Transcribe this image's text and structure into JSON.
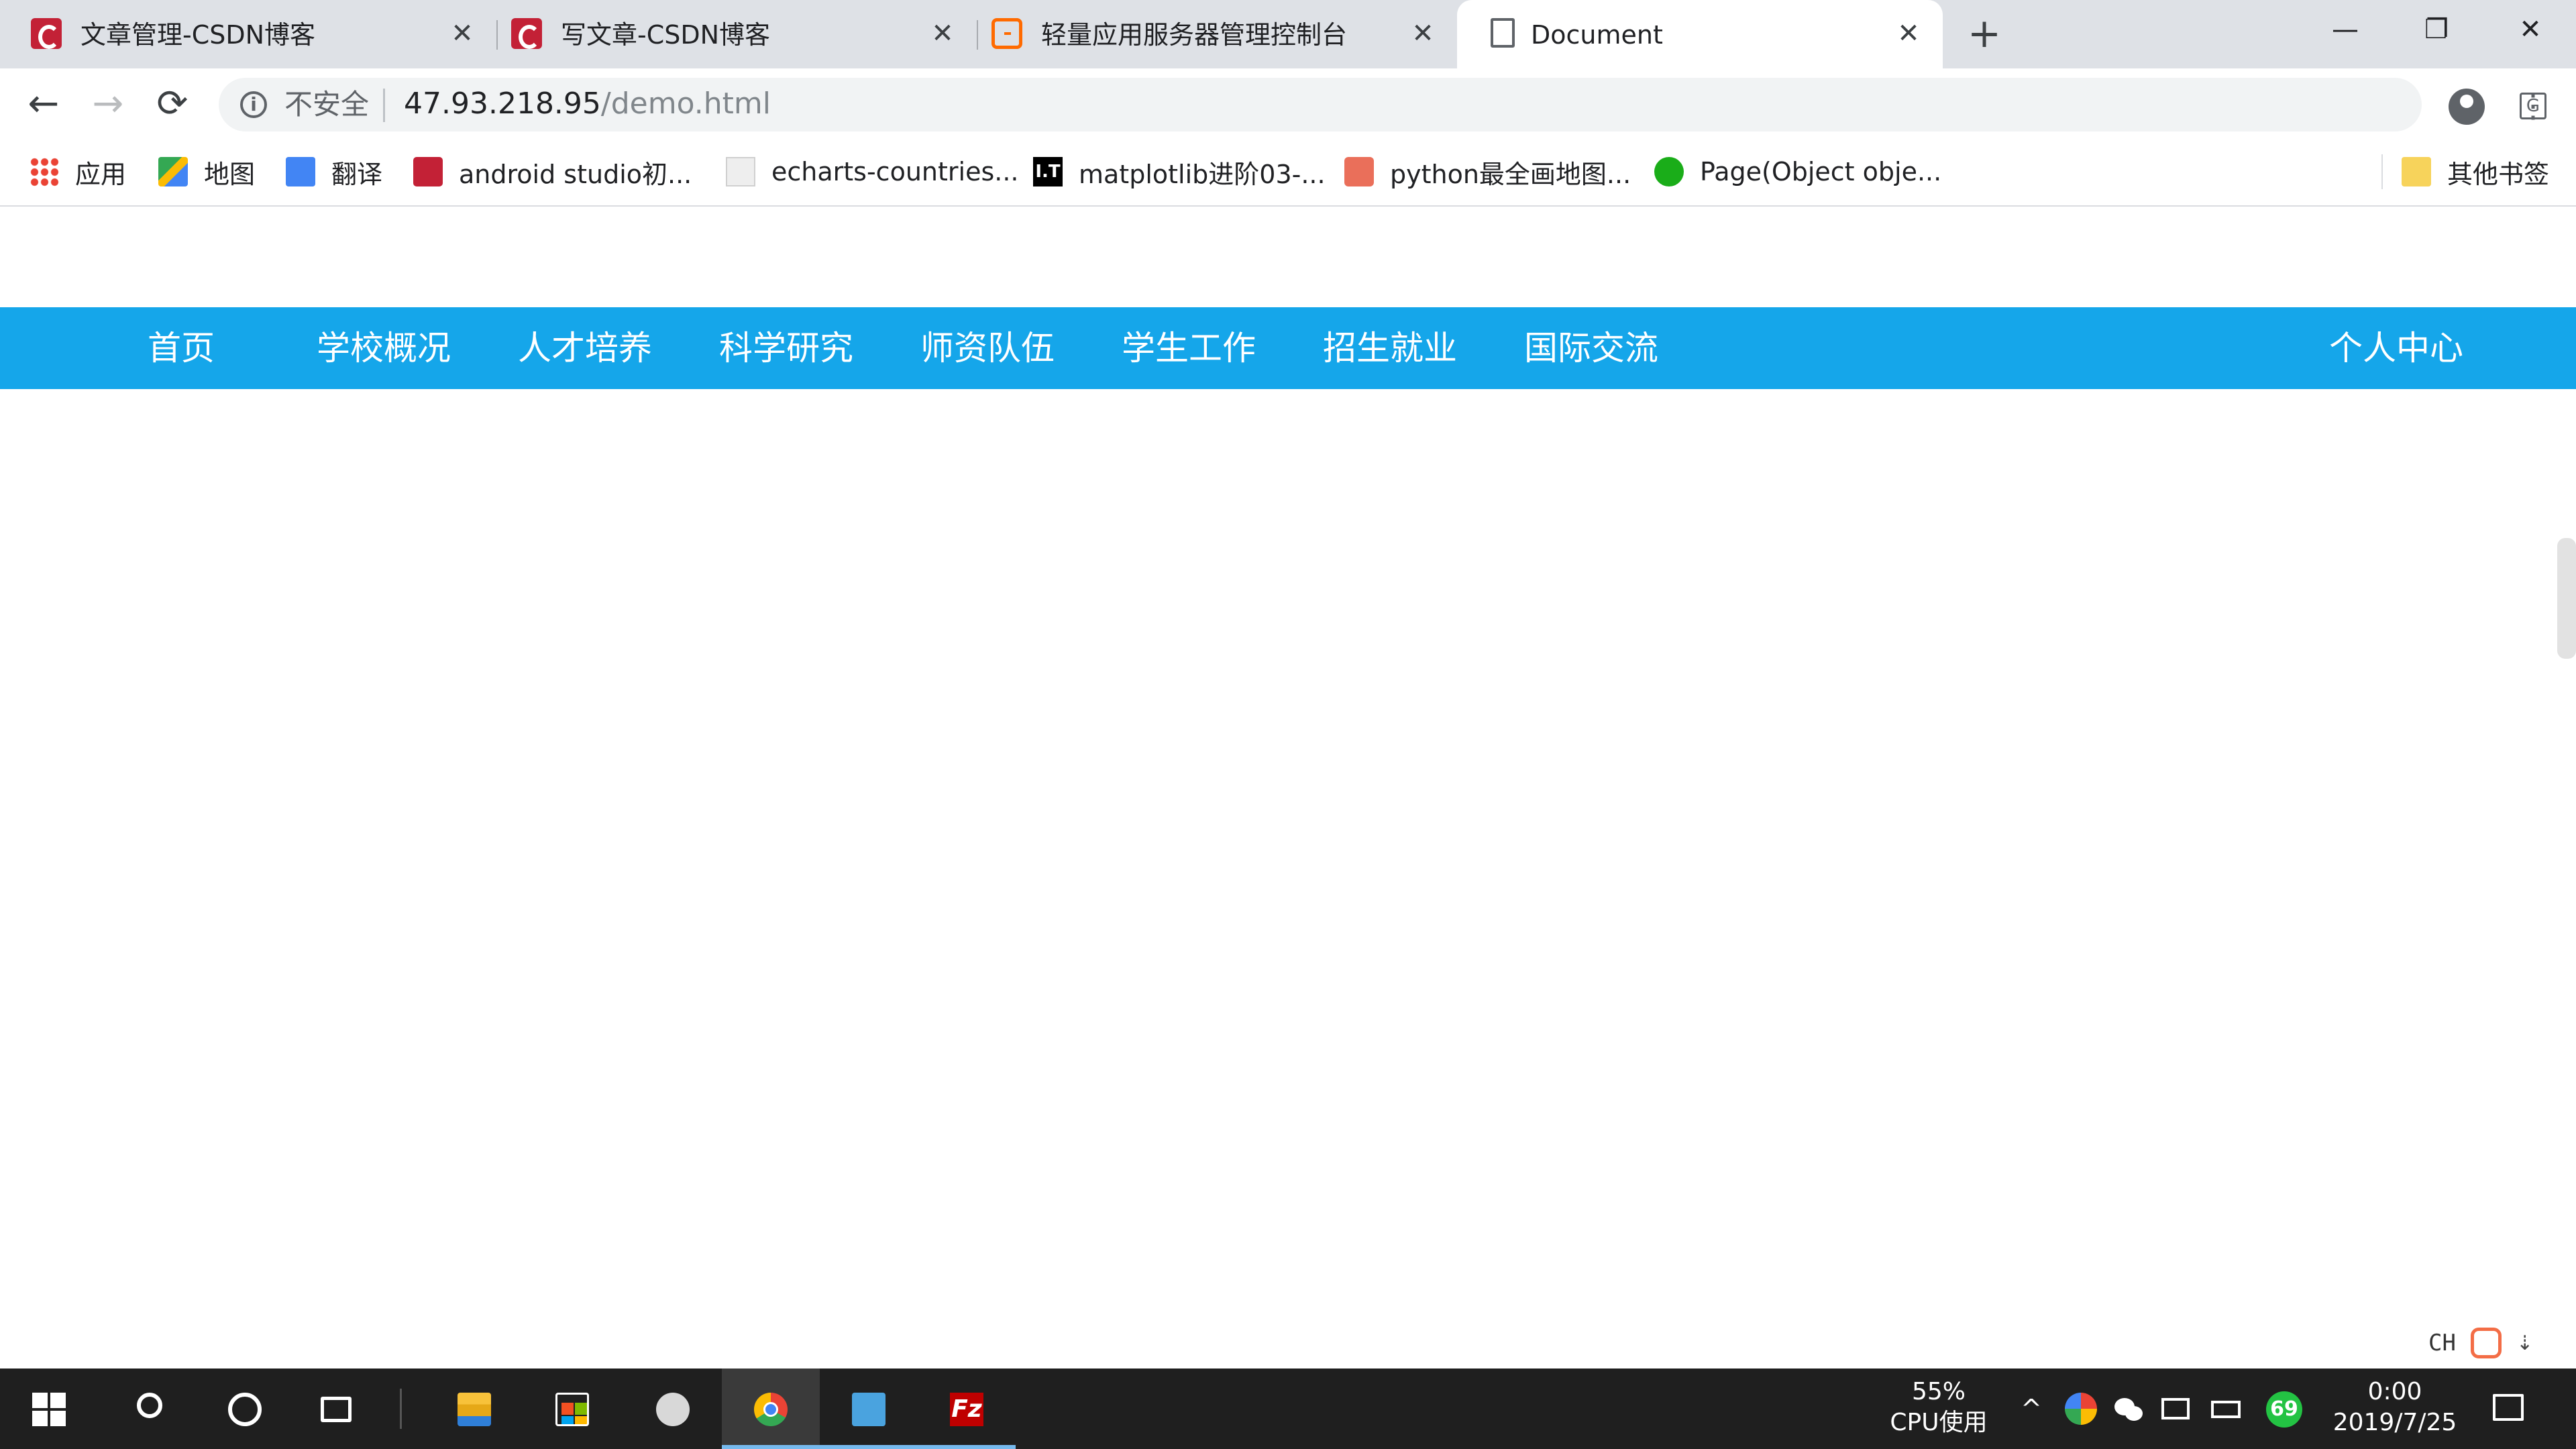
{
  "browser": {
    "tabs": [
      {
        "title": "文章管理-CSDN博客",
        "icon": "csdn-icon"
      },
      {
        "title": "写文章-CSDN博客",
        "icon": "csdn-icon"
      },
      {
        "title": "轻量应用服务器管理控制台",
        "icon": "aliyun-icon"
      },
      {
        "title": "Document",
        "icon": "document-icon",
        "active": true
      }
    ],
    "new_tab": "+",
    "close_glyph": "✕",
    "window_controls": {
      "minimize": "—",
      "restore": "❐",
      "close": "✕"
    },
    "nav": {
      "back": "←",
      "forward": "→",
      "reload": "⟳"
    },
    "omnibox": {
      "security_label": "不安全",
      "url_host": "47.93.218.95",
      "url_path": "/demo.html"
    },
    "menu_glyph": "⋮",
    "star_glyph": "☆",
    "translate_glyph": "G",
    "bookmarks": [
      {
        "label": "应用",
        "icon": "apps-grid-icon"
      },
      {
        "label": "地图",
        "icon": "maps-icon"
      },
      {
        "label": "翻译",
        "icon": "google-translate-icon"
      },
      {
        "label": "android studio初...",
        "icon": "csdn-icon"
      },
      {
        "label": "echarts-countries...",
        "icon": "page-icon"
      },
      {
        "label": "matplotlib进阶03-...",
        "icon": "lt-icon"
      },
      {
        "label": "python最全画地图...",
        "icon": "jianshu-icon"
      },
      {
        "label": "Page(Object obje...",
        "icon": "wechat-icon"
      }
    ],
    "other_bookmarks": "其他书签",
    "lt_text": "I.T"
  },
  "page": {
    "nav_items": [
      "首页",
      "学校概况",
      "人才培养",
      "科学研究",
      "师资队伍",
      "学生工作",
      "招生就业",
      "国际交流"
    ],
    "user_center": "个人中心",
    "nav_color": "#15a6ea"
  },
  "ime": {
    "mode": "CH",
    "arrow": "⇣"
  },
  "taskbar": {
    "cpu_percent": "55%",
    "cpu_label": "CPU使用",
    "tray_chevron": "^",
    "badge_count": "69",
    "time": "0:00",
    "date": "2019/7/25",
    "fz_text": "Fz"
  }
}
